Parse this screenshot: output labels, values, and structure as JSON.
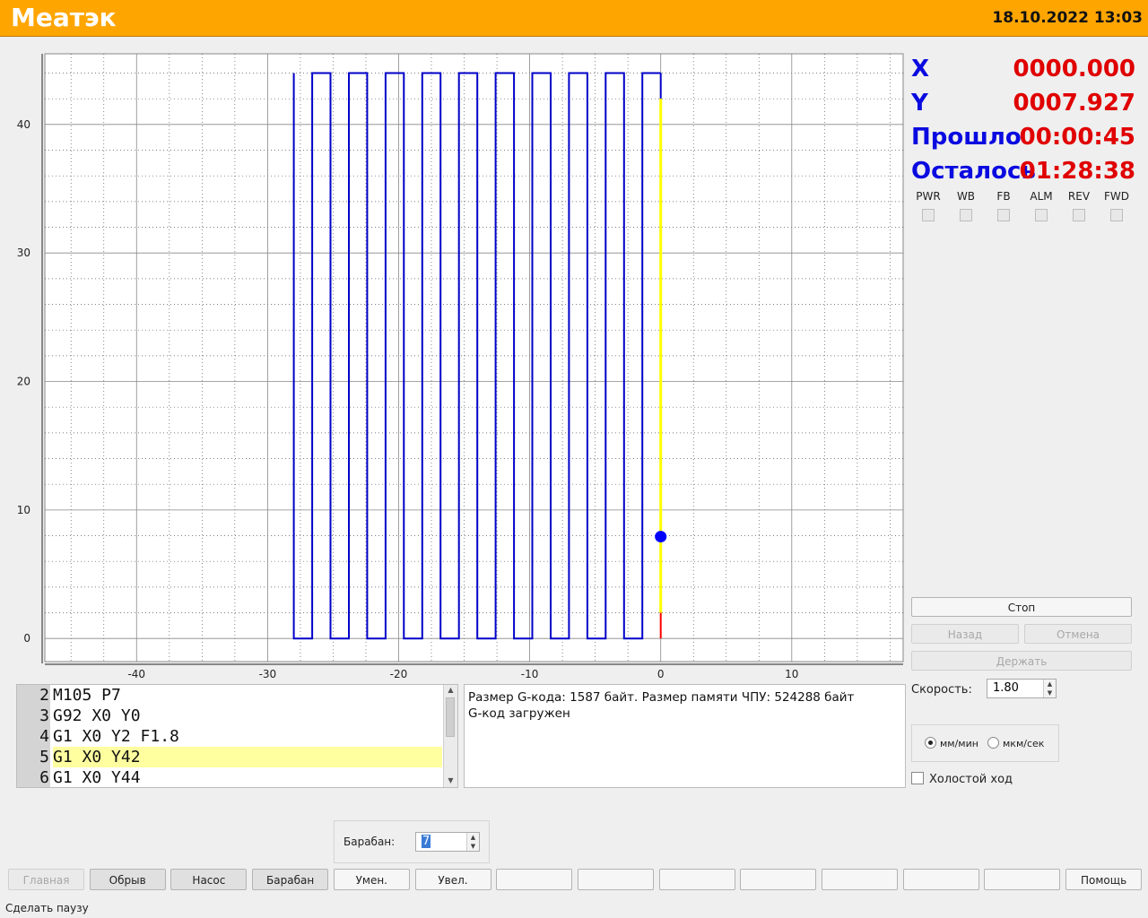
{
  "header": {
    "title": "Meaтэк",
    "datetime": "18.10.2022 13:03"
  },
  "readouts": [
    {
      "label": "X",
      "value": "0000.000"
    },
    {
      "label": "Y",
      "value": "0007.927"
    },
    {
      "label": "Прошло",
      "value": "00:00:45"
    },
    {
      "label": "Осталось",
      "value": "01:28:38"
    }
  ],
  "indicators": [
    "PWR",
    "WB",
    "FB",
    "ALM",
    "REV",
    "FWD"
  ],
  "controls": {
    "stop": "Стоп",
    "back": "Назад",
    "cancel": "Отмена",
    "hold": "Держать",
    "speed_label": "Скорость:",
    "speed_value": "1.80",
    "unit_mm": "мм/мин",
    "unit_um": "мкм/сек",
    "idle_label": "Холостой ход"
  },
  "code_lines": [
    {
      "num": "2",
      "text": "M105 P7"
    },
    {
      "num": "3",
      "text": "G92 X0 Y0"
    },
    {
      "num": "4",
      "text": "G1 X0 Y2 F1.8"
    },
    {
      "num": "5",
      "text": "G1 X0 Y42"
    },
    {
      "num": "6",
      "text": "G1 X0 Y44"
    }
  ],
  "messages": [
    "Размер G-кода: 1587 байт. Размер памяти ЧПУ: 524288 байт",
    "G-код загружен"
  ],
  "drum": {
    "label": "Барабан:",
    "value": "7"
  },
  "toolbar": [
    "Главная",
    "Обрыв",
    "Насос",
    "Барабан",
    "Умен.",
    "Увел.",
    "",
    "",
    "",
    "",
    "",
    "",
    "",
    "Помощь"
  ],
  "status": "Сделать паузу",
  "chart_data": {
    "type": "line",
    "x_ticks": [
      -40,
      -30,
      -20,
      -10,
      0,
      10
    ],
    "y_ticks": [
      0,
      10,
      20,
      30,
      40
    ],
    "xlim": [
      -47,
      18.5
    ],
    "ylim": [
      -1.8,
      45.5
    ],
    "grid": true,
    "toolpath_x": [
      -28.0,
      -26.6,
      -25.2,
      -23.8,
      -22.4,
      -21.0,
      -19.6,
      -18.2,
      -16.8,
      -15.4,
      -14.0,
      -12.6,
      -11.2,
      -9.8,
      -8.4,
      -7.0,
      -5.6,
      -4.2,
      -2.8,
      -1.4,
      0.0
    ],
    "toolpath_ymax": 44,
    "toolpath_ymin": 0,
    "done_y": [
      0,
      2
    ],
    "active_y": [
      2,
      42
    ],
    "current_position": {
      "x": 0.0,
      "y": 7.927
    },
    "colors": {
      "path": "#0000c8",
      "active": "#ffff00",
      "done": "#ff0000",
      "marker": "#0000ff"
    }
  }
}
